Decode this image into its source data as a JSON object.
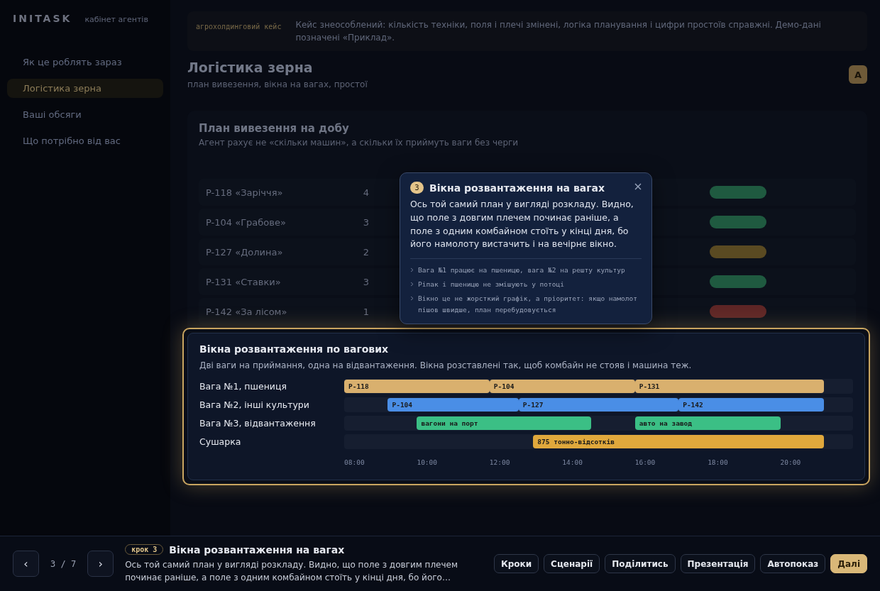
{
  "sidebar": {
    "brand": "INITASK",
    "brand_note": "кабінет агентів",
    "items": [
      {
        "label": "Як це роблять зараз",
        "selected": false
      },
      {
        "label": "Логістика зерна",
        "selected": true
      },
      {
        "label": "Ваші обсяги",
        "selected": false
      },
      {
        "label": "Що потрібно від вас",
        "selected": false
      }
    ]
  },
  "banner": {
    "label": "агрохолдинговий кейс",
    "text": "Кейс знеособлений: кількість техніки, поля і плечі змінені, логіка планування і цифри простоїв справжні. Демо-дані позначені «Приклад»."
  },
  "page": {
    "title": "Логістика зерна",
    "subtitle": "план вивезення, вікна на вагах, простої",
    "avatar": "А"
  },
  "plan": {
    "title": "План вивезення на добу",
    "subtitle": "Агент рахує не «скільки машин», а скільки їх приймуть ваги без черги",
    "rows": [
      {
        "field": "P-118 «Заріччя»",
        "combines": "4",
        "color": "#1f5a40"
      },
      {
        "field": "P-104 «Грабове»",
        "combines": "3",
        "color": "#1f5a40"
      },
      {
        "field": "P-127 «Долина»",
        "combines": "2",
        "color": "#5a4a22"
      },
      {
        "field": "P-131 «Ставки»",
        "combines": "3",
        "color": "#1f5a40"
      },
      {
        "field": "P-142 «За лісом»",
        "combines": "1",
        "color": "#5e2626"
      }
    ]
  },
  "schedule": {
    "title": "Вікна розвантаження по вагових",
    "subtitle": "Дві ваги на приймання, одна на відвантаження. Вікна розставлені так, щоб комбайн не стояв і машина теж.",
    "ticks": [
      "08:00",
      "10:00",
      "12:00",
      "14:00",
      "16:00",
      "18:00",
      "20:00"
    ],
    "lanes": [
      {
        "label": "Вага №1, пшениця",
        "color": "#d9b06e",
        "bars": [
          "P-118",
          "P-104",
          "P-131"
        ]
      },
      {
        "label": "Вага №2, інші культури",
        "color": "#4a8ee6",
        "bars": [
          "P-104",
          "P-127",
          "P-142"
        ]
      },
      {
        "label": "Вага №3, відвантаження",
        "color": "#3bbf85",
        "bars": [
          "вагони на порт",
          "авто на завод"
        ]
      },
      {
        "label": "Сушарка",
        "color": "#e0a83c",
        "bars": [
          "875 тонно-відсотків"
        ]
      }
    ]
  },
  "popover": {
    "step": "3",
    "title": "Вікна розвантаження на вагах",
    "text": "Ось той самий план у вигляді розкладу. Видно, що поле з довгим плечем починає раніше, а поле з одним комбайном стоїть у кінці дня, бо його намолоту вистачить і на вечірнє вікно.",
    "notes": [
      "Вага №1 працює на пшеницю, вага №2 на решту культур",
      "Ріпак і пшеницю не змішують у потоці",
      "Вікно це не жорсткий графік, а пріоритет: якщо намолот пішов швидше, план перебудовується"
    ]
  },
  "tour": {
    "prev": "‹",
    "counter": "3 / 7",
    "next": "›",
    "step_badge": "крок 3",
    "title": "Вікна розвантаження на вагах",
    "text": "Ось той самий план у вигляді розкладу. Видно, що поле з довгим плечем починає раніше, а поле з одним комбайном стоїть у кінці дня, бо його…",
    "buttons": [
      {
        "label": "Кроки",
        "primary": false
      },
      {
        "label": "Сценарії",
        "primary": false
      },
      {
        "label": "Поділитись",
        "primary": false
      },
      {
        "label": "Презентація",
        "primary": false
      },
      {
        "label": "Автопоказ",
        "primary": false
      },
      {
        "label": "Далі",
        "primary": true
      }
    ]
  }
}
